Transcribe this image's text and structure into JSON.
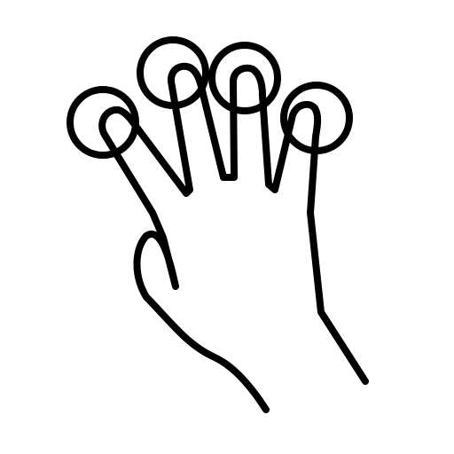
{
  "icon": {
    "name": "four-finger-tap-icon",
    "stroke_color": "#000000",
    "background_color": "#ffffff"
  }
}
